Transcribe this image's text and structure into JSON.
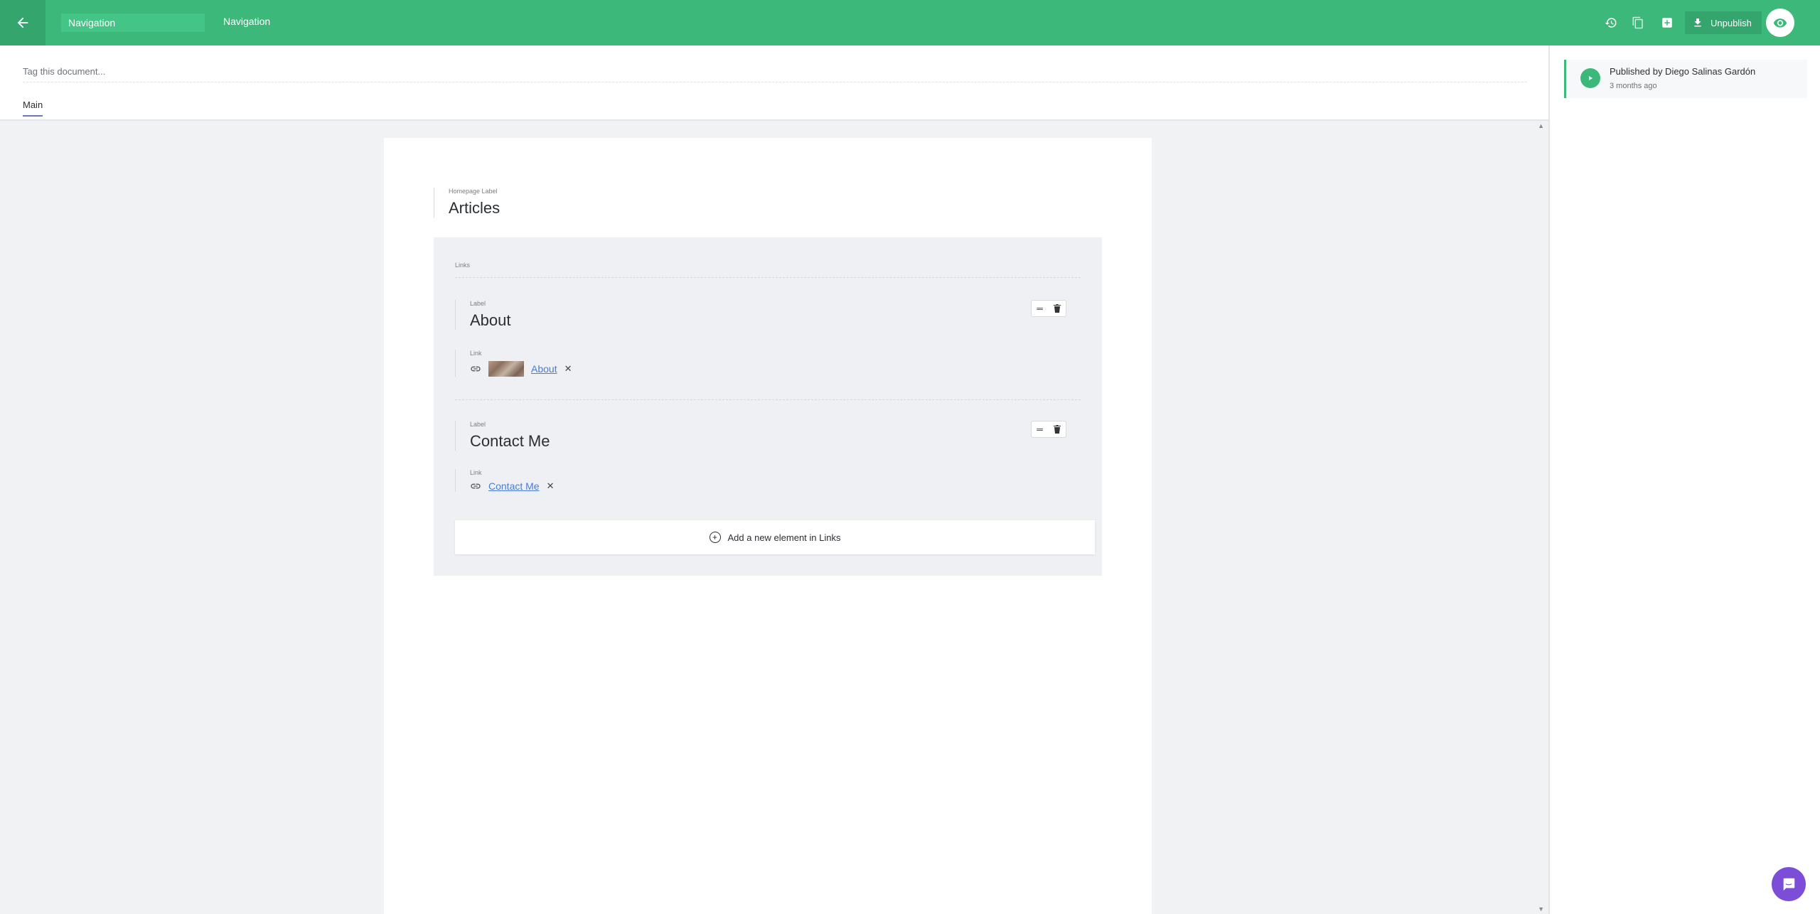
{
  "header": {
    "document_title": "Navigation",
    "custom_type": "Navigation",
    "unpublish_label": "Unpublish",
    "accent_color": "#3bb87a"
  },
  "tags": {
    "placeholder": "Tag this document..."
  },
  "tabs": [
    {
      "label": "Main"
    }
  ],
  "document": {
    "homepage_label": {
      "label": "Homepage Label",
      "value": "Articles"
    },
    "links_group": {
      "label": "Links",
      "items": [
        {
          "label_field": "Label",
          "label_value": "About",
          "link_field": "Link",
          "link_text": "About",
          "has_thumbnail": true
        },
        {
          "label_field": "Label",
          "label_value": "Contact Me",
          "link_field": "Link",
          "link_text": "Contact Me",
          "has_thumbnail": false
        }
      ],
      "add_label": "Add a new element in Links"
    }
  },
  "sidebar": {
    "release": {
      "title": "Published by Diego Salinas Gardón",
      "time": "3 months ago"
    }
  },
  "icons": {
    "back": "arrow-left-icon",
    "history": "history-icon",
    "duplicate": "copy-icon",
    "save": "save-icon",
    "download": "download-icon",
    "preview": "eye-icon",
    "chat": "chat-icon"
  }
}
